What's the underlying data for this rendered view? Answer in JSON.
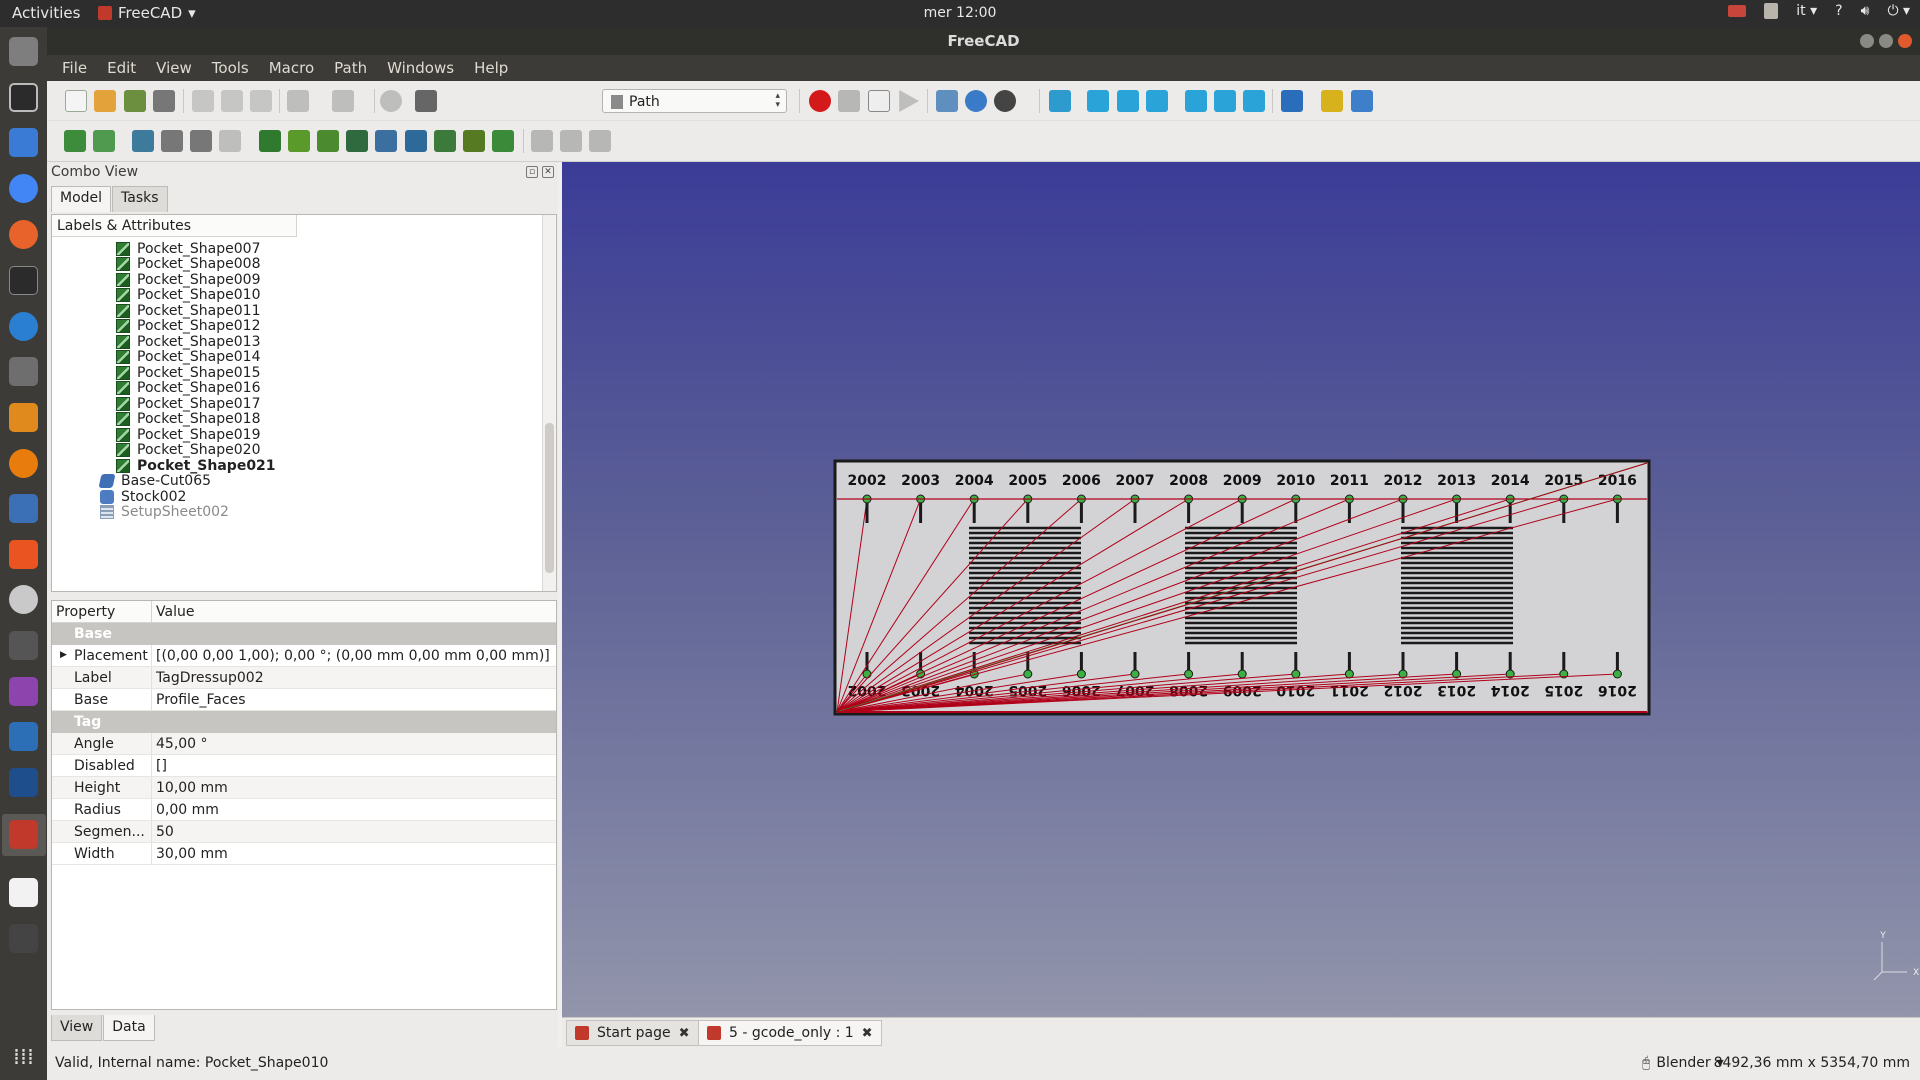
{
  "topbar": {
    "activities": "Activities",
    "app_name": "FreeCAD",
    "clock": "mer 12:00",
    "lang": "it",
    "help": "?"
  },
  "window": {
    "title": "FreeCAD"
  },
  "menubar": [
    "File",
    "Edit",
    "View",
    "Tools",
    "Macro",
    "Path",
    "Windows",
    "Help"
  ],
  "toolbar": {
    "workbench": "Path"
  },
  "combo_view": {
    "title": "Combo View",
    "tabs": [
      "Model",
      "Tasks"
    ],
    "tree_header": "Labels & Attributes",
    "tree_items": [
      {
        "label": "Pocket_Shape007",
        "icon": "pocket-icon"
      },
      {
        "label": "Pocket_Shape008",
        "icon": "pocket-icon"
      },
      {
        "label": "Pocket_Shape009",
        "icon": "pocket-icon"
      },
      {
        "label": "Pocket_Shape010",
        "icon": "pocket-icon"
      },
      {
        "label": "Pocket_Shape011",
        "icon": "pocket-icon"
      },
      {
        "label": "Pocket_Shape012",
        "icon": "pocket-icon"
      },
      {
        "label": "Pocket_Shape013",
        "icon": "pocket-icon"
      },
      {
        "label": "Pocket_Shape014",
        "icon": "pocket-icon"
      },
      {
        "label": "Pocket_Shape015",
        "icon": "pocket-icon"
      },
      {
        "label": "Pocket_Shape016",
        "icon": "pocket-icon"
      },
      {
        "label": "Pocket_Shape017",
        "icon": "pocket-icon"
      },
      {
        "label": "Pocket_Shape018",
        "icon": "pocket-icon"
      },
      {
        "label": "Pocket_Shape019",
        "icon": "pocket-icon"
      },
      {
        "label": "Pocket_Shape020",
        "icon": "pocket-icon"
      },
      {
        "label": "Pocket_Shape021",
        "icon": "pocket-icon"
      },
      {
        "label": "Base-Cut065",
        "icon": "base-shape-icon"
      },
      {
        "label": "Stock002",
        "icon": "stock-icon"
      },
      {
        "label": "SetupSheet002",
        "icon": "setup-sheet-icon"
      }
    ],
    "property_header": {
      "property": "Property",
      "value": "Value"
    },
    "groups": [
      {
        "name": "Base",
        "rows": [
          {
            "key": "Placement",
            "value": "[(0,00 0,00 1,00); 0,00 °; (0,00 mm  0,00 mm  0,00 mm)]"
          },
          {
            "key": "Label",
            "value": "TagDressup002"
          },
          {
            "key": "Base",
            "value": "Profile_Faces"
          }
        ]
      },
      {
        "name": "Tag",
        "rows": [
          {
            "key": "Angle",
            "value": "45,00 °"
          },
          {
            "key": "Disabled",
            "value": "[]"
          },
          {
            "key": "Height",
            "value": "10,00 mm"
          },
          {
            "key": "Radius",
            "value": "0,00 mm"
          },
          {
            "key": "Segmen...",
            "value": "50"
          },
          {
            "key": "Width",
            "value": "30,00 mm"
          }
        ]
      }
    ],
    "bottom_tabs": [
      "View",
      "Data"
    ]
  },
  "viewport": {
    "years_top": [
      "2002",
      "2003",
      "2004",
      "2005",
      "2006",
      "2007",
      "2008",
      "2009",
      "2010",
      "2011",
      "2012",
      "2013",
      "2014",
      "2015",
      "2016"
    ],
    "years_bottom": [
      "2002",
      "2003",
      "2004",
      "2005",
      "2006",
      "2007",
      "2008",
      "2009",
      "2010",
      "2011",
      "2012",
      "2013",
      "2014",
      "2015",
      "2016"
    ],
    "axis_labels": {
      "y": "Y",
      "x": "X"
    },
    "colors": {
      "bg_top": "#3b3c97",
      "bg_bottom": "#9295ab",
      "toolpath": "#b0001a",
      "rapid": "#2a9d2a"
    }
  },
  "document_tabs": [
    {
      "label": "Start page"
    },
    {
      "label": "5 - gcode_only : 1"
    }
  ],
  "statusbar": {
    "message": "Valid, Internal name: Pocket_Shape010",
    "navigation": "Blender",
    "dimensions": "8492,36 mm x 5354,70 mm"
  }
}
